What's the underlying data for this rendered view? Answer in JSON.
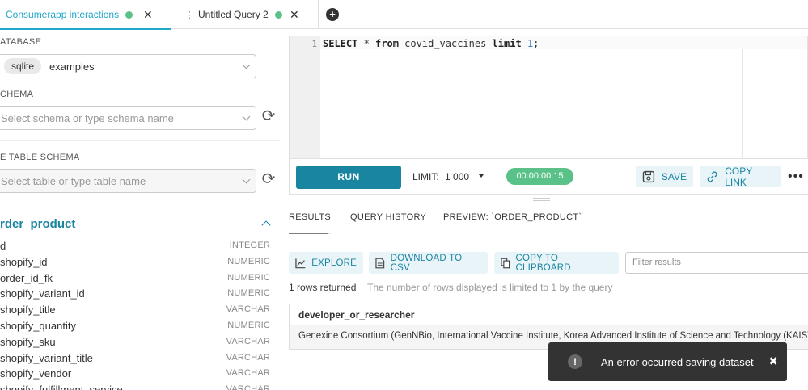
{
  "tabs": [
    {
      "label": "Consumerapp interactions",
      "status": "saved"
    },
    {
      "label": "Untitled Query 2",
      "status": "saved"
    }
  ],
  "sidebar": {
    "database": {
      "label": "ATABASE",
      "backend": "sqlite",
      "value": "examples"
    },
    "schema": {
      "label": "CHEMA",
      "placeholder": "Select schema or type schema name"
    },
    "table": {
      "label": "E TABLE SCHEMA",
      "placeholder": "Select table or type table name"
    },
    "selected_table": {
      "name": "rder_product",
      "columns": [
        {
          "name": "d",
          "type": "INTEGER"
        },
        {
          "name": "shopify_id",
          "type": "NUMERIC"
        },
        {
          "name": "order_id_fk",
          "type": "NUMERIC"
        },
        {
          "name": "shopify_variant_id",
          "type": "NUMERIC"
        },
        {
          "name": "shopify_title",
          "type": "VARCHAR"
        },
        {
          "name": "shopify_quantity",
          "type": "NUMERIC"
        },
        {
          "name": "shopify_sku",
          "type": "VARCHAR"
        },
        {
          "name": "shopify_variant_title",
          "type": "VARCHAR"
        },
        {
          "name": "shopify_vendor",
          "type": "VARCHAR"
        },
        {
          "name": "shopify_fulfillment_service",
          "type": "VARCHAR"
        }
      ]
    }
  },
  "editor": {
    "line_number": "1",
    "sql": {
      "kw1": "SELECT",
      "t1": " * ",
      "kw2": "from",
      "t2": " covid_vaccines ",
      "kw3": "limit",
      "t3": " ",
      "num": "1",
      "t4": ";"
    }
  },
  "toolbar": {
    "run_label": "RUN",
    "limit_label": "LIMIT:",
    "limit_value": "1 000",
    "timer": "00:00:00.15",
    "save_label": "SAVE",
    "copy_link_label": "COPY LINK"
  },
  "results": {
    "tabs": [
      "RESULTS",
      "QUERY HISTORY",
      "PREVIEW: `ORDER_PRODUCT`"
    ],
    "explore_label": "EXPLORE",
    "download_label": "DOWNLOAD TO CSV",
    "clipboard_label": "COPY TO CLIPBOARD",
    "filter_placeholder": "Filter results",
    "rows_returned": "1 rows returned",
    "limit_note": "The number of rows displayed is limited to 1 by the query",
    "columns": [
      "developer_or_researcher"
    ],
    "rows": [
      [
        "Genexine Consortium (GenNBio, International Vaccine Institute, Korea Advanced Institute of Science and Technology (KAIST"
      ]
    ]
  },
  "toast": {
    "message": "An error occurred saving dataset"
  },
  "colors": {
    "accent": "#20a7c9",
    "primary": "#1a85a0",
    "success": "#5ac189",
    "toast_bg": "#333333"
  }
}
